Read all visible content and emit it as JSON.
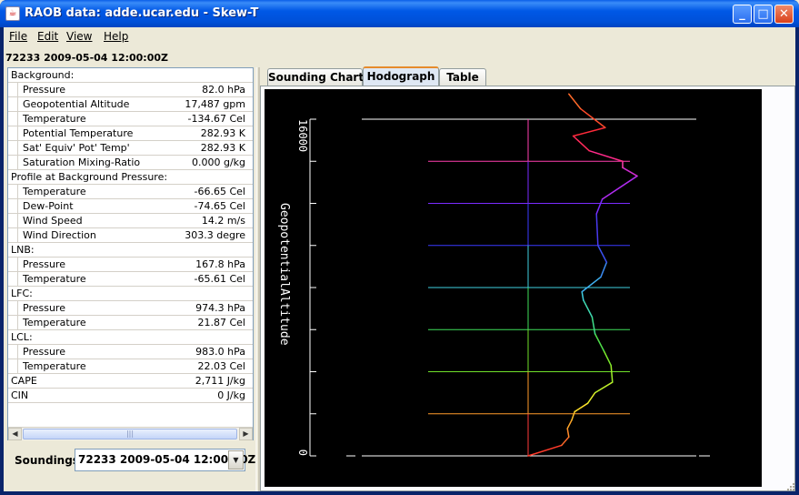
{
  "window": {
    "title": "RAOB data: adde.ucar.edu - Skew-T"
  },
  "menubar": {
    "file": "File",
    "edit": "Edit",
    "view": "View",
    "help": "Help"
  },
  "header": {
    "label": "72233 2009-05-04 12:00:00Z"
  },
  "table_rows": [
    {
      "kind": "hdr",
      "label": "Background:",
      "value": ""
    },
    {
      "kind": "sub",
      "label": "Pressure",
      "value": "82.0 hPa"
    },
    {
      "kind": "sub",
      "label": "Geopotential Altitude",
      "value": "17,487 gpm"
    },
    {
      "kind": "sub",
      "label": "Temperature",
      "value": "-134.67 Cel"
    },
    {
      "kind": "sub",
      "label": "Potential Temperature",
      "value": "282.93 K"
    },
    {
      "kind": "sub",
      "label": "Sat' Equiv' Pot' Temp'",
      "value": "282.93 K"
    },
    {
      "kind": "sub",
      "label": "Saturation Mixing-Ratio",
      "value": "0.000 g/kg"
    },
    {
      "kind": "hdr",
      "label": "Profile at Background Pressure:",
      "value": ""
    },
    {
      "kind": "sub",
      "label": "Temperature",
      "value": "-66.65 Cel"
    },
    {
      "kind": "sub",
      "label": "Dew-Point",
      "value": "-74.65 Cel"
    },
    {
      "kind": "sub",
      "label": "Wind Speed",
      "value": "14.2 m/s"
    },
    {
      "kind": "sub",
      "label": "Wind Direction",
      "value": "303.3 degre"
    },
    {
      "kind": "hdr",
      "label": "LNB:",
      "value": ""
    },
    {
      "kind": "sub",
      "label": "Pressure",
      "value": "167.8 hPa"
    },
    {
      "kind": "sub",
      "label": "Temperature",
      "value": "-65.61 Cel"
    },
    {
      "kind": "hdr",
      "label": "LFC:",
      "value": ""
    },
    {
      "kind": "sub",
      "label": "Pressure",
      "value": "974.3 hPa"
    },
    {
      "kind": "sub",
      "label": "Temperature",
      "value": "21.87 Cel"
    },
    {
      "kind": "hdr",
      "label": "LCL:",
      "value": ""
    },
    {
      "kind": "sub",
      "label": "Pressure",
      "value": "983.0 hPa"
    },
    {
      "kind": "sub",
      "label": "Temperature",
      "value": "22.03 Cel"
    },
    {
      "kind": "hdr",
      "label": "CAPE",
      "value": "2,711 J/kg"
    },
    {
      "kind": "hdr",
      "label": "CIN",
      "value": "0 J/kg"
    }
  ],
  "soundings": {
    "label": "Soundings:",
    "selected": "72233 2009-05-04 12:00:00Z"
  },
  "tabs": {
    "sounding": "Sounding Chart",
    "hodograph": "Hodograph",
    "table": "Table",
    "active": "Hodograph"
  },
  "icons": {
    "app": "java-cup-icon",
    "minimize": "minimize-icon",
    "maximize": "maximize-icon",
    "close": "close-icon",
    "dropdown": "chevron-down-icon"
  },
  "colors": {
    "chart_background": "#000000",
    "titlebar": "#0054e3",
    "active_tab_accent": "#e68b2c"
  },
  "chart_data": {
    "type": "line",
    "title": "",
    "ylabel": "GeopotentialAltitude",
    "ylim": [
      0,
      16000
    ],
    "y_ticks": [
      {
        "value": 0,
        "label": "0"
      },
      {
        "value": 16000,
        "label": "16000"
      }
    ],
    "altitude_levels": [
      {
        "altitude": 16000,
        "color": "#ffffff",
        "wide": true
      },
      {
        "altitude": 14000,
        "color": "#ff3fb0",
        "wide": false
      },
      {
        "altitude": 12000,
        "color": "#7a2cff",
        "wide": false
      },
      {
        "altitude": 10000,
        "color": "#3a3aff",
        "wide": false
      },
      {
        "altitude": 8000,
        "color": "#3fd0e0",
        "wide": false
      },
      {
        "altitude": 6000,
        "color": "#3fe05a",
        "wide": false
      },
      {
        "altitude": 4000,
        "color": "#6fe02a",
        "wide": false
      },
      {
        "altitude": 2000,
        "color": "#ff9a2a",
        "wide": false
      },
      {
        "altitude": 0,
        "color": "#ffffff",
        "wide": true
      }
    ],
    "center_line": {
      "color": "#ff3a3a",
      "top_color": "#ffd23a"
    },
    "profile": [
      {
        "alt": 0,
        "u": 0.0,
        "color": "#ff2a2a"
      },
      {
        "alt": 500,
        "u": 2.3,
        "color": "#ff3a2a"
      },
      {
        "alt": 900,
        "u": 2.8,
        "color": "#ff6a2a"
      },
      {
        "alt": 1300,
        "u": 2.7,
        "color": "#ff8a2a"
      },
      {
        "alt": 1700,
        "u": 3.0,
        "color": "#ffa52a"
      },
      {
        "alt": 2100,
        "u": 3.2,
        "color": "#ffc02a"
      },
      {
        "alt": 2500,
        "u": 4.1,
        "color": "#ffe02a"
      },
      {
        "alt": 3000,
        "u": 4.6,
        "color": "#e8f02a"
      },
      {
        "alt": 3500,
        "u": 5.8,
        "color": "#c0f02a"
      },
      {
        "alt": 4300,
        "u": 5.7,
        "color": "#9ef02a"
      },
      {
        "alt": 5000,
        "u": 5.2,
        "color": "#7ae82a"
      },
      {
        "alt": 5800,
        "u": 4.6,
        "color": "#4fe04a"
      },
      {
        "alt": 6600,
        "u": 4.4,
        "color": "#3fe08a"
      },
      {
        "alt": 7400,
        "u": 3.8,
        "color": "#3fd8b0"
      },
      {
        "alt": 7800,
        "u": 3.7,
        "color": "#3fd0e0"
      },
      {
        "alt": 8500,
        "u": 5.0,
        "color": "#3fb0f0"
      },
      {
        "alt": 9200,
        "u": 5.4,
        "color": "#3a8af0"
      },
      {
        "alt": 10000,
        "u": 4.8,
        "color": "#3a50f0"
      },
      {
        "alt": 11500,
        "u": 4.7,
        "color": "#4a3af0"
      },
      {
        "alt": 12200,
        "u": 5.1,
        "color": "#7a2cff"
      },
      {
        "alt": 13300,
        "u": 7.5,
        "color": "#b02cf0"
      },
      {
        "alt": 13700,
        "u": 6.5,
        "color": "#d02cd0"
      },
      {
        "alt": 14000,
        "u": 6.5,
        "color": "#ff3fb0"
      },
      {
        "alt": 14500,
        "u": 4.2,
        "color": "#ff2a8a"
      },
      {
        "alt": 15200,
        "u": 3.1,
        "color": "#ff2a5a"
      },
      {
        "alt": 15600,
        "u": 5.3,
        "color": "#ff2a3a"
      },
      {
        "alt": 16500,
        "u": 3.6,
        "color": "#ff4a2a"
      },
      {
        "alt": 17200,
        "u": 2.8,
        "color": "#ff6a2a"
      }
    ]
  }
}
